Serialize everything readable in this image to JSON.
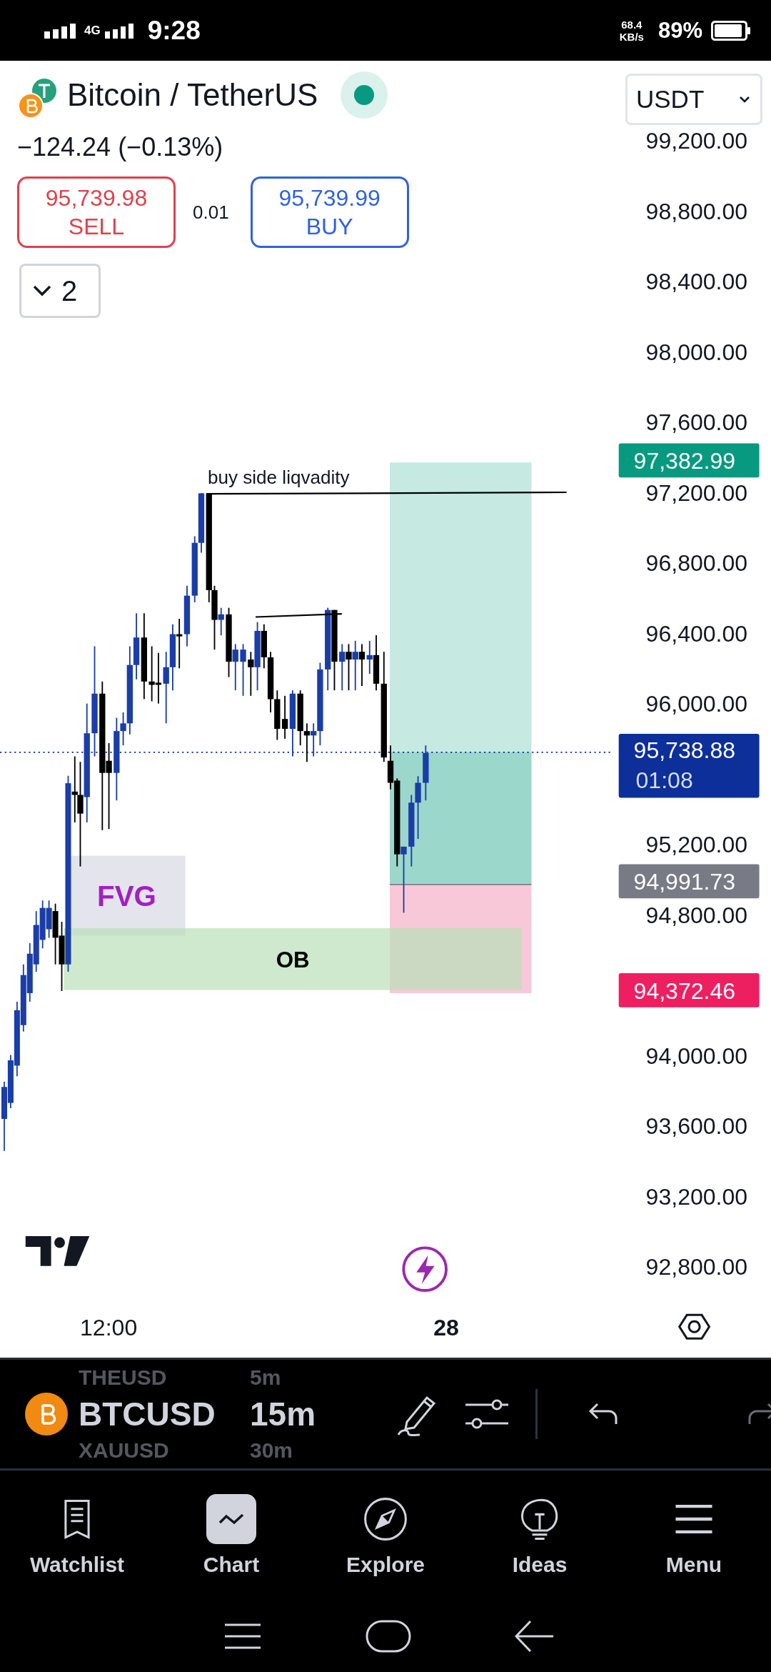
{
  "status_bar": {
    "time": "9:28",
    "network": "4G",
    "speed": "68.4",
    "speed_unit": "KB/s",
    "battery": "89%"
  },
  "header": {
    "title": "Bitcoin / TetherUS",
    "live": true,
    "currency": "USDT",
    "change": "−124.24 (−0.13%)",
    "spread": "0.01",
    "indicators_count": "2",
    "sell": {
      "price": "95,739.98",
      "label": "SELL"
    },
    "buy": {
      "price": "95,739.99",
      "label": "BUY"
    }
  },
  "chart": {
    "price_axis": [
      "99,200.00",
      "98,800.00",
      "98,400.00",
      "98,000.00",
      "97,600.00",
      "97,200.00",
      "96,800.00",
      "96,400.00",
      "96,000.00",
      "95,200.00",
      "94,800.00",
      "94,000.00",
      "93,600.00",
      "93,200.00",
      "92,800.00"
    ],
    "markers": [
      {
        "value": "97,382.99",
        "color": "#089981"
      },
      {
        "value": "95,738.88",
        "countdown": "01:08",
        "color": "#0c2f9a"
      },
      {
        "value": "94,991.73",
        "color": "#787b86"
      },
      {
        "value": "94,372.46",
        "color": "#ee1f61"
      }
    ],
    "liquidity_label": "buy side liqvadity",
    "fvg_label": "FVG",
    "ob_label": "OB",
    "time_axis": [
      {
        "label": "12:00",
        "kind": "time"
      },
      {
        "label": "28",
        "kind": "day"
      }
    ]
  },
  "toolbar": {
    "symbols": [
      {
        "label": "THEUSD",
        "selected": false
      },
      {
        "label": "BTCUSD",
        "selected": true
      },
      {
        "label": "XAUUSD",
        "selected": false
      }
    ],
    "timeframes": [
      {
        "label": "5m",
        "selected": false
      },
      {
        "label": "15m",
        "selected": true
      },
      {
        "label": "30m",
        "selected": false
      }
    ]
  },
  "nav": {
    "items": [
      {
        "label": "Watchlist",
        "kind": "watchlist",
        "selected": false
      },
      {
        "label": "Chart",
        "kind": "chart",
        "selected": true
      },
      {
        "label": "Explore",
        "kind": "explore",
        "selected": false
      },
      {
        "label": "Ideas",
        "kind": "ideas",
        "selected": false
      },
      {
        "label": "Menu",
        "kind": "menu",
        "selected": false
      }
    ]
  }
}
